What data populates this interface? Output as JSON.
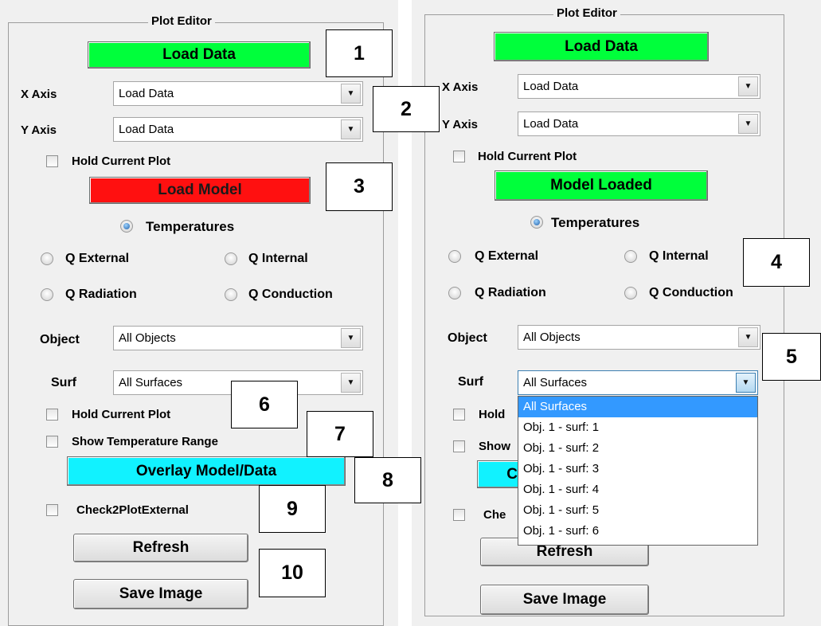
{
  "panel_title": "Plot Editor",
  "buttons": {
    "load_data": "Load Data",
    "load_model": "Load Model",
    "model_loaded": "Model Loaded",
    "overlay": "Overlay Model/Data",
    "refresh": "Refresh",
    "save_image": "Save Image"
  },
  "labels": {
    "x_axis": "X Axis",
    "y_axis": "Y Axis",
    "object": "Object",
    "surf": "Surf"
  },
  "dropdowns": {
    "x_axis_value": "Load Data",
    "y_axis_value": "Load Data",
    "object_value": "All Objects",
    "surf_value": "All Surfaces"
  },
  "checkboxes": {
    "hold_current_plot": "Hold Current Plot",
    "show_temp_range": "Show Temperature Range",
    "check2plot": "Check2PlotExternal"
  },
  "right_truncated": {
    "hold": "Hold",
    "show": "Show",
    "check": "Che",
    "overlay_initial": "C"
  },
  "radios": {
    "temperatures": "Temperatures",
    "q_external": "Q External",
    "q_internal": "Q Internal",
    "q_radiation": "Q Radiation",
    "q_conduction": "Q Conduction"
  },
  "surf_options": [
    "All Surfaces",
    "Obj. 1 - surf: 1",
    "Obj. 1 - surf: 2",
    "Obj. 1 - surf: 3",
    "Obj. 1 - surf: 4",
    "Obj. 1 - surf: 5",
    "Obj. 1 - surf: 6"
  ],
  "surf_selected_index": 0,
  "callouts": [
    "1",
    "2",
    "3",
    "4",
    "5",
    "6",
    "7",
    "8",
    "9",
    "10"
  ],
  "icons": {
    "dropdown_arrow": "dropdown-arrow-icon",
    "radio": "radio-button",
    "checkbox": "checkbox"
  },
  "colors": {
    "green_button": "#00ff3b",
    "red_button": "#ff1010",
    "cyan_button": "#11f2ff",
    "selected_item": "#3399ff"
  }
}
